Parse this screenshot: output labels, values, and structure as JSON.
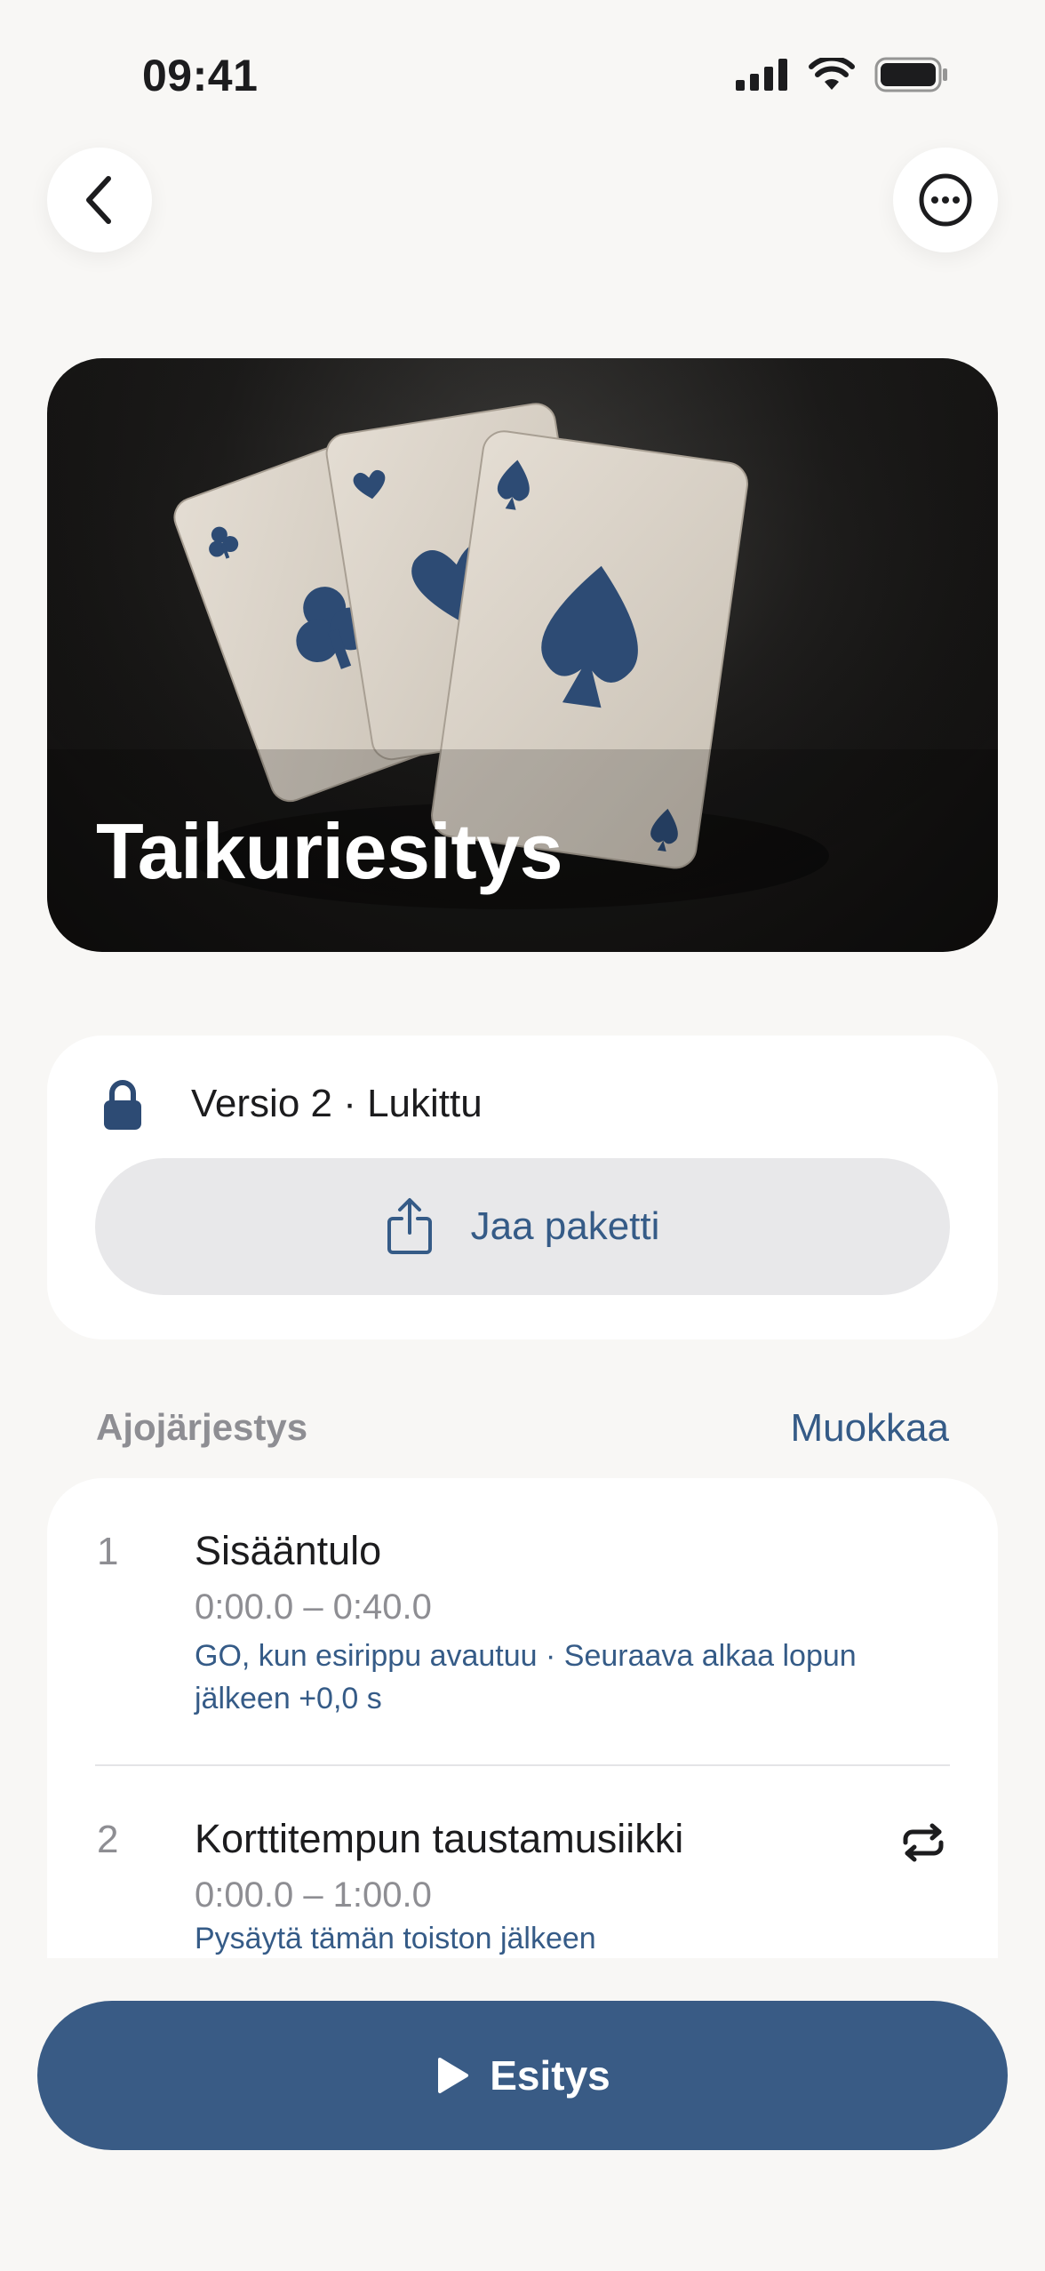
{
  "status_bar": {
    "time": "09:41",
    "icons": [
      "cellular-signal-icon",
      "wifi-icon",
      "battery-icon"
    ]
  },
  "nav": {
    "back_icon": "chevron-left-icon",
    "more_icon": "ellipsis-circle-icon"
  },
  "hero": {
    "title": "Taikuriesitys",
    "image": "three-playing-cards-illustration"
  },
  "package": {
    "version_label": "Versio 2 · Lukittu",
    "lock_icon": "lock-icon",
    "share_label": "Jaa paketti",
    "share_icon": "share-icon"
  },
  "running_order": {
    "title": "Ajojärjestys",
    "edit_label": "Muokkaa",
    "cues": [
      {
        "number": "1",
        "name": "Sisääntulo",
        "time": "0:00.0 – 0:40.0",
        "note_line1": "GO, kun esirippu avautuu · Seuraava alkaa lopun",
        "note_line2": "jälkeen +0,0 s",
        "loop": false
      },
      {
        "number": "2",
        "name": "Korttitempun taustamusiikki",
        "time": "0:00.0 – 1:00.0",
        "note_line1": "Pysäytä tämän toiston jälkeen",
        "loop": true,
        "loop_icon": "repeat-icon"
      }
    ]
  },
  "primary_action": {
    "label": "Esitys",
    "icon": "play-icon"
  },
  "colors": {
    "accent": "#395b85",
    "link": "#355b87",
    "background": "#f8f7f5",
    "card": "#ffffff",
    "secondary_text": "#8e8e93"
  }
}
